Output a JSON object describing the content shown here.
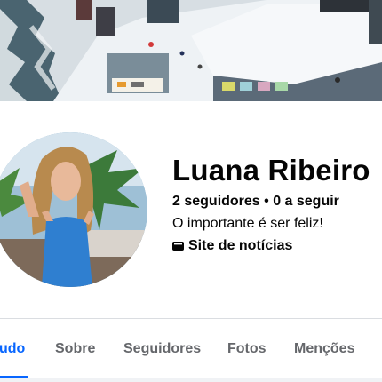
{
  "profile": {
    "name": "Luana Ribeiro",
    "counts": "2 seguidores • 0 a seguir",
    "bio": "O importante é ser feliz!",
    "category_icon": "news-icon",
    "category": "Site de notícias"
  },
  "tabs": [
    {
      "label": "udo",
      "active": true
    },
    {
      "label": "Sobre",
      "active": false
    },
    {
      "label": "Seguidores",
      "active": false
    },
    {
      "label": "Fotos",
      "active": false
    },
    {
      "label": "Menções",
      "active": false
    }
  ],
  "colors": {
    "accent": "#0866ff",
    "text_primary": "#050505",
    "text_secondary": "#65676b",
    "divider": "#dadde1"
  }
}
